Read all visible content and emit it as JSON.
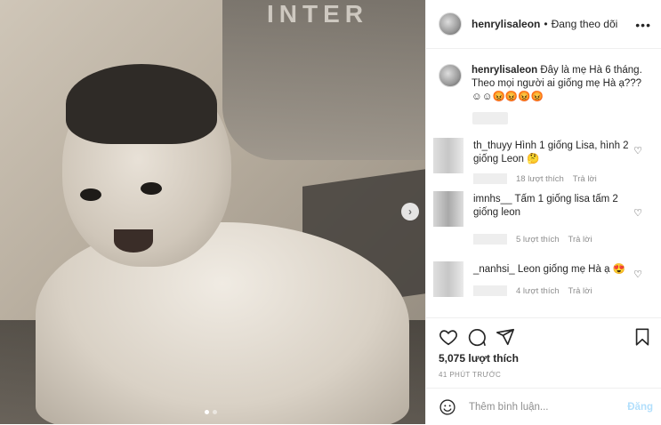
{
  "media": {
    "watermark_text": "INTER",
    "next_icon": "chevron-right-icon",
    "carousel_dots": [
      true,
      false
    ]
  },
  "header": {
    "username": "henrylisaleon",
    "separator": "•",
    "follow_status": "Đang theo dõi",
    "more_icon": "ellipsis-icon"
  },
  "caption": {
    "username": "henrylisaleon",
    "text": "Đây là mẹ Hà 6 tháng. Theo mọi người ai giống mẹ Hà ạ???",
    "emojis": "☺☺😡😡😡😡"
  },
  "comments": [
    {
      "username": "th_thuyy",
      "text": "Hình 1 giống Lisa, hình 2 giống Leon 🤔",
      "likes": "18 lượt thích",
      "reply": "Trả lời"
    },
    {
      "username": "imnhs__",
      "text": "Tấm 1 giống lisa tấm 2 giống leon",
      "likes": "5 lượt thích",
      "reply": "Trả lời"
    },
    {
      "username": "_nanhsi_",
      "text": "Leon giống mẹ Hà ạ 😍",
      "likes": "4 lượt thích",
      "reply": "Trả lời"
    }
  ],
  "actions": {
    "likes_count": "5,075 lượt thích",
    "time_ago": "41 PHÚT TRƯỚC"
  },
  "comment_box": {
    "placeholder": "Thêm bình luận...",
    "post_label": "Đăng"
  },
  "colors": {
    "accent": "#0095f6",
    "post_disabled": "#b2dffc",
    "border": "#efefef",
    "secondary_text": "#8e8e8e"
  }
}
